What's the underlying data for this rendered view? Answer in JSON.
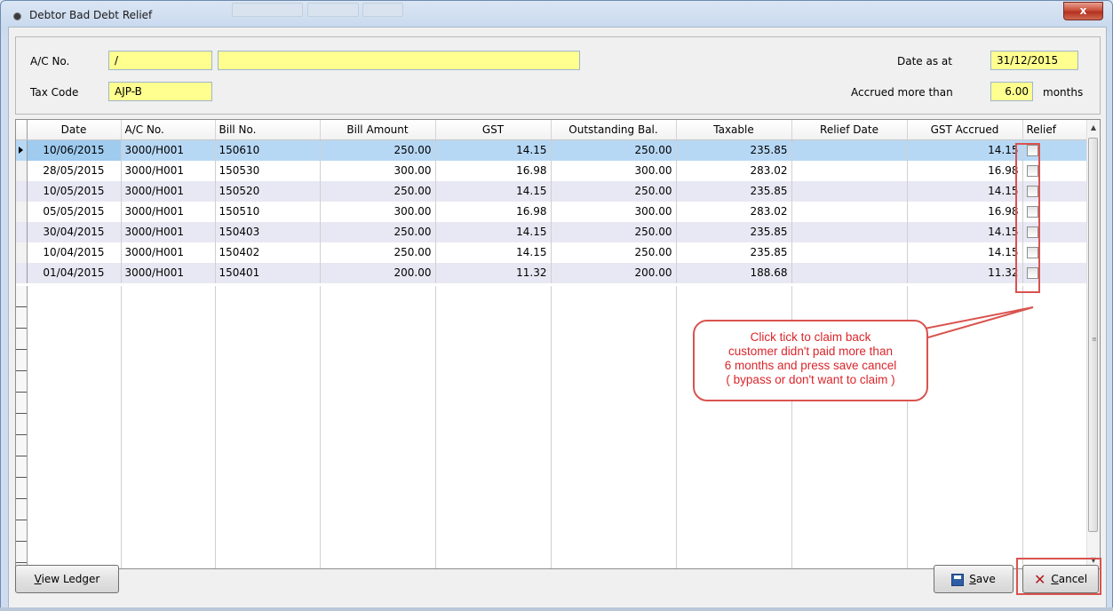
{
  "window": {
    "title": "Debtor Bad Debt Relief",
    "close_glyph": "x"
  },
  "header": {
    "ac_no_label": "A/C No.",
    "ac_no_value": "/",
    "ac_name_value": "",
    "tax_code_label": "Tax Code",
    "tax_code_value": "AJP-B",
    "date_as_at_label": "Date as at",
    "date_as_at_value": "31/12/2015",
    "accrued_label": "Accrued more than",
    "accrued_value": "6.00",
    "accrued_unit": "months"
  },
  "grid": {
    "columns": [
      "Date",
      "A/C No.",
      "Bill No.",
      "Bill Amount",
      "GST",
      "Outstanding Bal.",
      "Taxable",
      "Relief Date",
      "GST Accrued",
      "Relief"
    ],
    "rows": [
      {
        "date": "10/06/2015",
        "ac": "3000/H001",
        "bill": "150610",
        "amount": "250.00",
        "gst": "14.15",
        "outstanding": "250.00",
        "taxable": "235.85",
        "relief_date": "",
        "gst_accrued": "14.15",
        "relief": false
      },
      {
        "date": "28/05/2015",
        "ac": "3000/H001",
        "bill": "150530",
        "amount": "300.00",
        "gst": "16.98",
        "outstanding": "300.00",
        "taxable": "283.02",
        "relief_date": "",
        "gst_accrued": "16.98",
        "relief": false
      },
      {
        "date": "10/05/2015",
        "ac": "3000/H001",
        "bill": "150520",
        "amount": "250.00",
        "gst": "14.15",
        "outstanding": "250.00",
        "taxable": "235.85",
        "relief_date": "",
        "gst_accrued": "14.15",
        "relief": false
      },
      {
        "date": "05/05/2015",
        "ac": "3000/H001",
        "bill": "150510",
        "amount": "300.00",
        "gst": "16.98",
        "outstanding": "300.00",
        "taxable": "283.02",
        "relief_date": "",
        "gst_accrued": "16.98",
        "relief": false
      },
      {
        "date": "30/04/2015",
        "ac": "3000/H001",
        "bill": "150403",
        "amount": "250.00",
        "gst": "14.15",
        "outstanding": "250.00",
        "taxable": "235.85",
        "relief_date": "",
        "gst_accrued": "14.15",
        "relief": false
      },
      {
        "date": "10/04/2015",
        "ac": "3000/H001",
        "bill": "150402",
        "amount": "250.00",
        "gst": "14.15",
        "outstanding": "250.00",
        "taxable": "235.85",
        "relief_date": "",
        "gst_accrued": "14.15",
        "relief": false
      },
      {
        "date": "01/04/2015",
        "ac": "3000/H001",
        "bill": "150401",
        "amount": "200.00",
        "gst": "11.32",
        "outstanding": "200.00",
        "taxable": "188.68",
        "relief_date": "",
        "gst_accrued": "11.32",
        "relief": false
      }
    ],
    "selected_row": 0
  },
  "callout": {
    "lines": [
      "Click tick to claim back",
      "customer didn't paid more than",
      "6 months and press save cancel",
      "( bypass or don't want to claim )"
    ]
  },
  "buttons": {
    "view_ledger": {
      "mnemonic": "V",
      "rest": "iew Ledger"
    },
    "save": {
      "mnemonic": "S",
      "rest": "ave"
    },
    "cancel": {
      "mnemonic": "C",
      "rest": "ancel"
    }
  },
  "colors": {
    "field_yellow": "#ffff90",
    "selected_row": "#b7d8f5",
    "alt_row": "#e8e8f4",
    "annotation_red": "#d9534f"
  }
}
